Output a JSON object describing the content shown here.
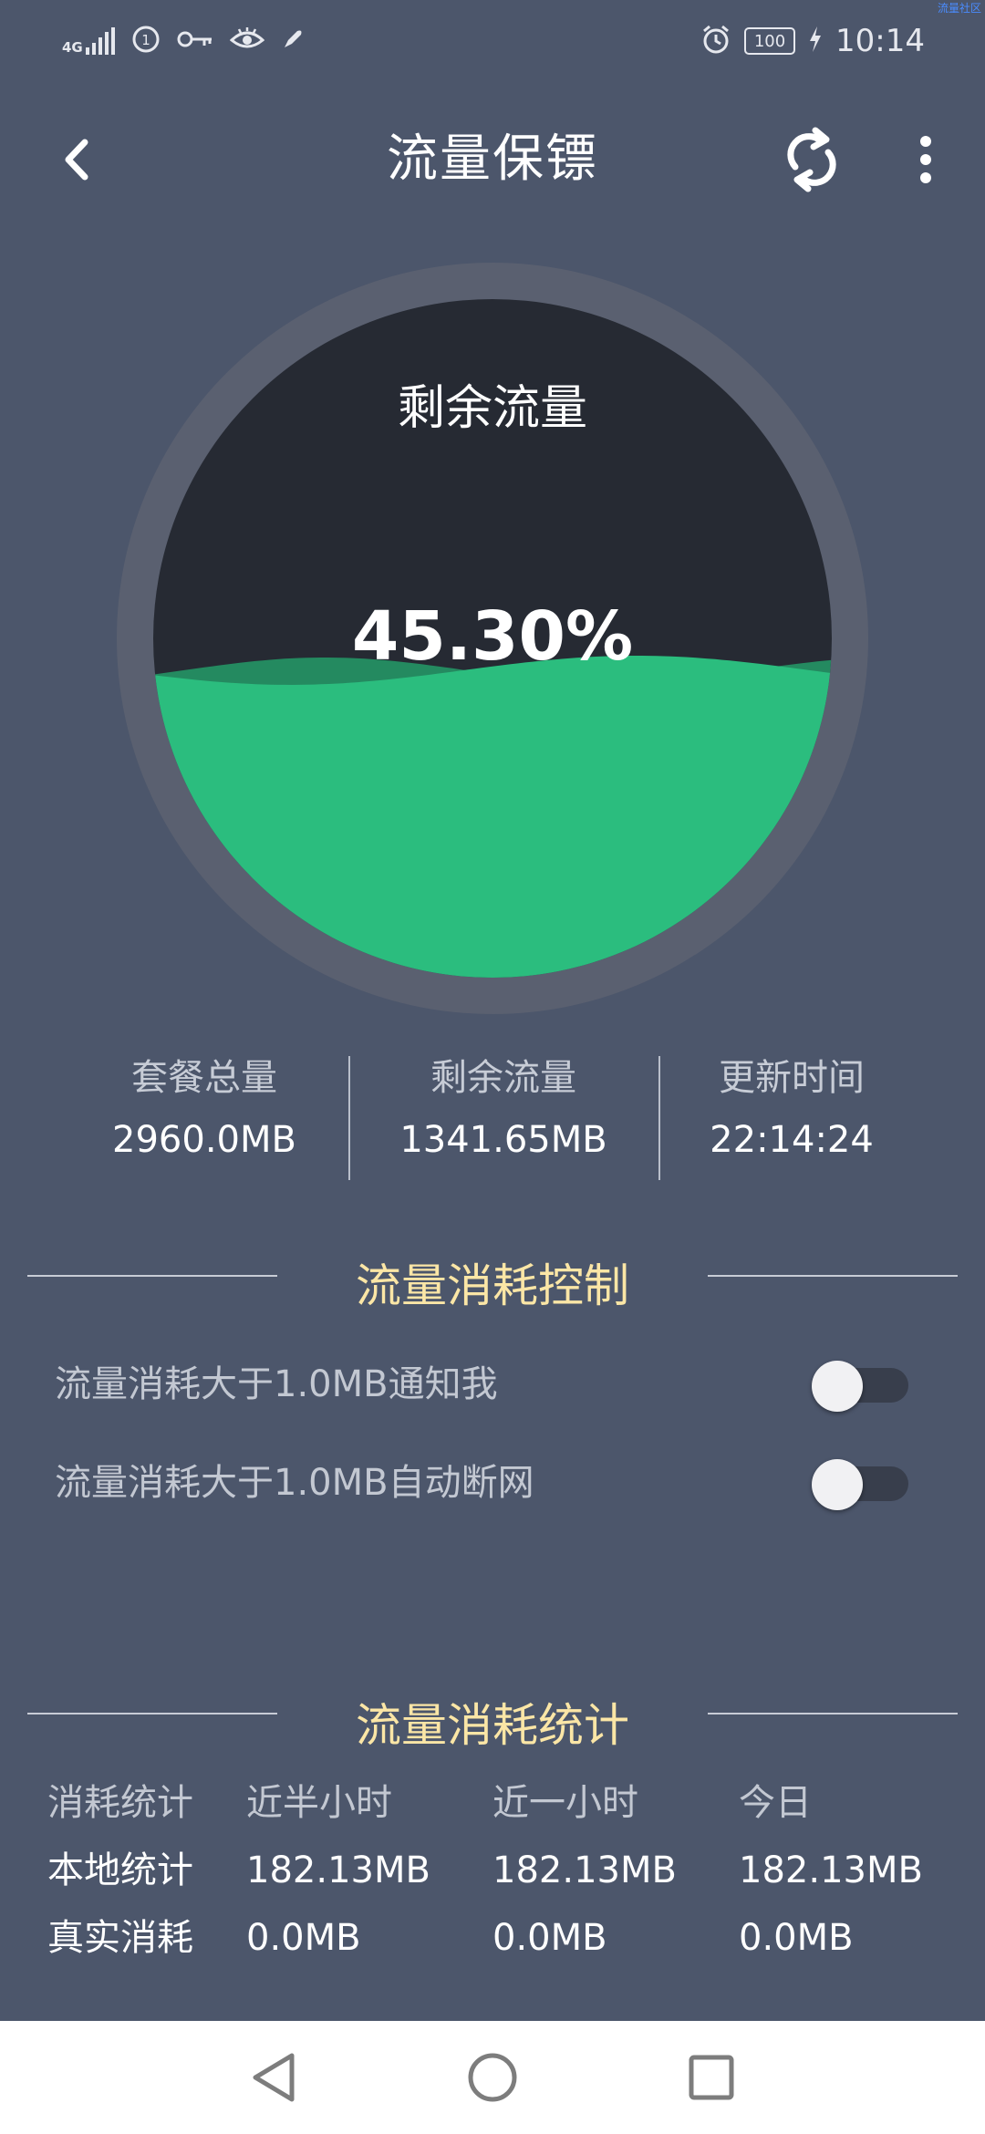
{
  "colors": {
    "background": "#4c566b",
    "gauge_ring": "#5a6070",
    "gauge_empty": "#262a33",
    "wave_front": "#2bbd7e",
    "wave_back": "#248a60",
    "section_title": "#fbe6a6"
  },
  "status_bar": {
    "network": "4G",
    "time": "10:14",
    "battery": "100",
    "icons": [
      "signal-icon",
      "hd-call-icon",
      "key-icon",
      "eye-icon",
      "rocket-icon",
      "alarm-icon",
      "battery-icon",
      "charging-icon"
    ],
    "watermark": "流量社区"
  },
  "app_bar": {
    "title": "流量保镖",
    "icons": [
      "back-icon",
      "refresh-icon",
      "more-vert-icon"
    ]
  },
  "gauge": {
    "label": "剩余流量",
    "percent_text": "45.30%",
    "remaining_fraction": 0.453
  },
  "stats": [
    {
      "label": "套餐总量",
      "value": "2960.0MB"
    },
    {
      "label": "剩余流量",
      "value": "1341.65MB"
    },
    {
      "label": "更新时间",
      "value": "22:14:24"
    }
  ],
  "control": {
    "title": "流量消耗控制",
    "toggles": [
      {
        "label": "流量消耗大于1.0MB通知我",
        "on": false
      },
      {
        "label": "流量消耗大于1.0MB自动断网",
        "on": false
      }
    ]
  },
  "statistics": {
    "title": "流量消耗统计",
    "columns": [
      "消耗统计",
      "近半小时",
      "近一小时",
      "今日"
    ],
    "rows": [
      [
        "本地统计",
        "182.13MB",
        "182.13MB",
        "182.13MB"
      ],
      [
        "真实消耗",
        "0.0MB",
        "0.0MB",
        "0.0MB"
      ]
    ]
  },
  "nav_bar": {
    "icons": [
      "back-triangle-icon",
      "home-circle-icon",
      "recents-square-icon"
    ]
  }
}
